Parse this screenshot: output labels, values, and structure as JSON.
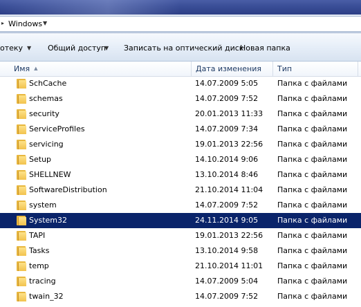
{
  "address": {
    "crumbs": [
      "Windows"
    ]
  },
  "toolbar": {
    "library_label": "отеку",
    "share_label": "Общий доступ",
    "burn_label": "Записать на оптический диск",
    "new_folder_label": "Новая папка"
  },
  "columns": {
    "name": "Имя",
    "date": "Дата изменения",
    "type": "Тип"
  },
  "colors": {
    "selection": "#0a246a",
    "folder": "#f2c24e",
    "header_text": "#1e3a64"
  },
  "files": [
    {
      "name": "SchCache",
      "date": "14.07.2009 5:05",
      "type": "Папка с файлами",
      "selected": false
    },
    {
      "name": "schemas",
      "date": "14.07.2009 7:52",
      "type": "Папка с файлами",
      "selected": false
    },
    {
      "name": "security",
      "date": "20.01.2013 11:33",
      "type": "Папка с файлами",
      "selected": false
    },
    {
      "name": "ServiceProfiles",
      "date": "14.07.2009 7:34",
      "type": "Папка с файлами",
      "selected": false
    },
    {
      "name": "servicing",
      "date": "19.01.2013 22:56",
      "type": "Папка с файлами",
      "selected": false
    },
    {
      "name": "Setup",
      "date": "14.10.2014 9:06",
      "type": "Папка с файлами",
      "selected": false
    },
    {
      "name": "SHELLNEW",
      "date": "13.10.2014 8:46",
      "type": "Папка с файлами",
      "selected": false
    },
    {
      "name": "SoftwareDistribution",
      "date": "21.10.2014 11:04",
      "type": "Папка с файлами",
      "selected": false
    },
    {
      "name": "system",
      "date": "14.07.2009 7:52",
      "type": "Папка с файлами",
      "selected": false
    },
    {
      "name": "System32",
      "date": "24.11.2014 9:05",
      "type": "Папка с файлами",
      "selected": true
    },
    {
      "name": "TAPI",
      "date": "19.01.2013 22:56",
      "type": "Папка с файлами",
      "selected": false
    },
    {
      "name": "Tasks",
      "date": "13.10.2014 9:58",
      "type": "Папка с файлами",
      "selected": false
    },
    {
      "name": "temp",
      "date": "21.10.2014 11:01",
      "type": "Папка с файлами",
      "selected": false
    },
    {
      "name": "tracing",
      "date": "14.07.2009 5:04",
      "type": "Папка с файлами",
      "selected": false
    },
    {
      "name": "twain_32",
      "date": "14.07.2009 7:52",
      "type": "Папка с файлами",
      "selected": false
    }
  ]
}
